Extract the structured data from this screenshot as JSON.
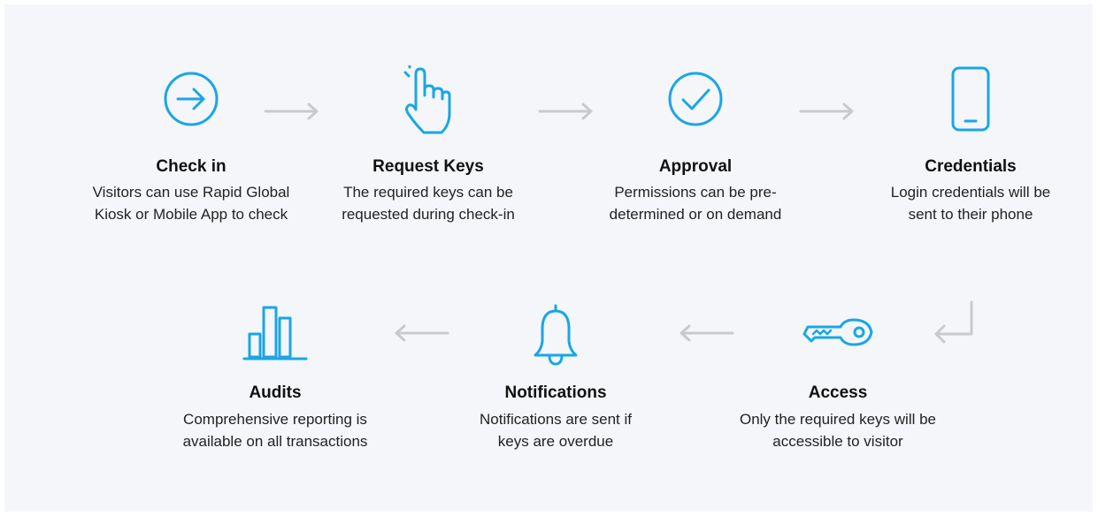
{
  "colors": {
    "accent": "#1aa6e6",
    "arrow": "#c9cacc",
    "background": "#f4f6f9"
  },
  "steps": [
    {
      "icon": "arrow-circle-icon",
      "title": "Check in",
      "desc1": "Visitors can use Rapid Global",
      "desc2": "Kiosk or Mobile App to check"
    },
    {
      "icon": "hand-pointer-icon",
      "title": "Request Keys",
      "desc1": "The required keys can be",
      "desc2": "requested during check-in"
    },
    {
      "icon": "check-circle-icon",
      "title": "Approval",
      "desc1": "Permissions can be pre-",
      "desc2": "determined or on demand"
    },
    {
      "icon": "phone-icon",
      "title": "Credentials",
      "desc1": "Login credentials will be",
      "desc2": "sent to their phone"
    },
    {
      "icon": "key-icon",
      "title": "Access",
      "desc1": "Only the required keys will be",
      "desc2": "accessible to visitor"
    },
    {
      "icon": "bell-icon",
      "title": "Notifications",
      "desc1": "Notifications are sent if",
      "desc2": "keys are overdue"
    },
    {
      "icon": "bar-chart-icon",
      "title": "Audits",
      "desc1": "Comprehensive reporting is",
      "desc2": "available on all transactions"
    }
  ]
}
